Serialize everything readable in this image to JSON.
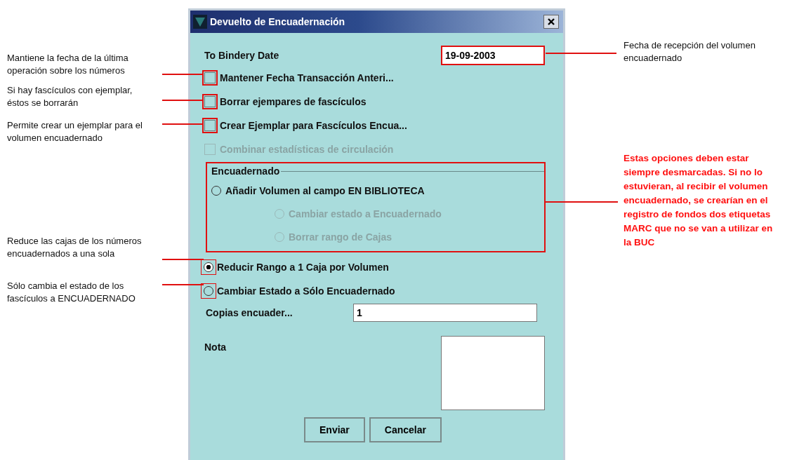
{
  "window": {
    "title": "Devuelto de Encuadernación"
  },
  "date_field": {
    "label": "To Bindery Date",
    "value": "19-09-2003",
    "highlighted": true
  },
  "checkboxes": [
    {
      "label": "Mantener Fecha Transacción Anteri...",
      "checked": false,
      "disabled": false,
      "highlighted": true
    },
    {
      "label": "Borrar ejempares de fascículos",
      "checked": false,
      "disabled": false,
      "highlighted": true
    },
    {
      "label": "Crear Ejemplar para Fascículos Encua...",
      "checked": false,
      "disabled": false,
      "highlighted": true
    },
    {
      "label": "Combinar estadísticas de circulación",
      "checked": false,
      "disabled": true,
      "highlighted": false
    }
  ],
  "group": {
    "title": "Encuadernado",
    "highlighted": true,
    "options": [
      {
        "label": "Añadir Volumen al campo EN BIBLIOTECA",
        "selected": false,
        "disabled": false,
        "children": [
          {
            "label": "Cambiar estado a Encuadernado",
            "selected": false,
            "disabled": true
          },
          {
            "label": "Borrar rango de Cajas",
            "selected": false,
            "disabled": true
          }
        ]
      }
    ]
  },
  "radios": [
    {
      "label": "Reducir Rango a 1 Caja por Volumen",
      "selected": true,
      "highlighted": true
    },
    {
      "label": "Cambiar Estado a Sólo Encuadernado",
      "selected": false,
      "highlighted": true
    }
  ],
  "copies_field": {
    "label": "Copias encuader...",
    "value": "1"
  },
  "note_field": {
    "label": "Nota"
  },
  "buttons": [
    {
      "label": "Enviar"
    },
    {
      "label": "Cancelar"
    }
  ],
  "left_notes": [
    {
      "text": "Mantiene la fecha de la última operación sobre los números"
    },
    {
      "text": "Si hay fascículos con ejemplar, éstos se borrarán"
    },
    {
      "text": "Permite crear un ejemplar para el volumen encuadernado"
    },
    {
      "text": "Reduce las cajas de los números encuadernados a una sola"
    },
    {
      "text": "Sólo cambia el estado de los fascículos a ENCUADERNADO"
    }
  ],
  "right_notes": [
    {
      "text": "Fecha de recepción del volumen encuadernado",
      "emphasis": false
    },
    {
      "text": "Estas opciones deben estar siempre desmarcadas. Si no lo estuvieran, al recibir el volumen encuadernado, se crearían en el registro de fondos dos etiquetas MARC que no se van a utilizar en la BUC",
      "emphasis": true
    }
  ]
}
